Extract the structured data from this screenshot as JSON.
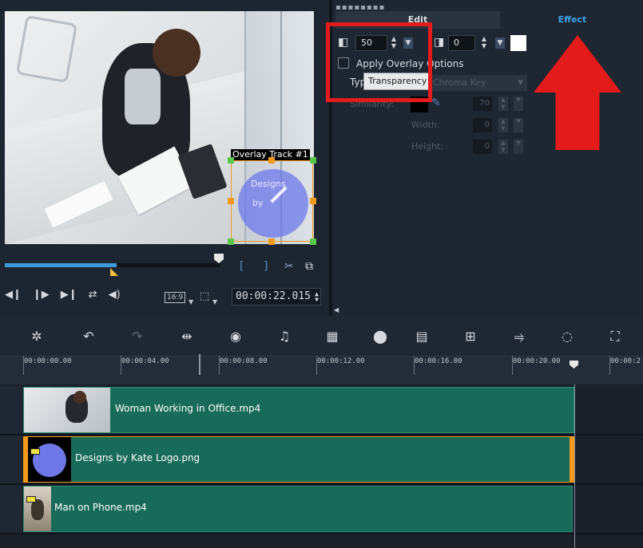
{
  "preview": {
    "overlay_label": "Overlay Track #1",
    "logo_text_1": "Designs",
    "logo_text_2": "by",
    "scrub_progress": 0.52,
    "aspect_label": "16:9",
    "timecode": "00:00:22.015",
    "icons": {
      "trim_in": "bracket-left-icon",
      "trim_out": "bracket-right-icon",
      "split": "scissors-icon",
      "copy": "copy-icon",
      "transport": [
        "prev-frame-icon",
        "next-frame-icon",
        "end-icon",
        "repeat-icon",
        "volume-icon"
      ]
    }
  },
  "options": {
    "tabs": [
      {
        "label": "Edit",
        "active": false
      },
      {
        "label": "Effect",
        "active": true
      }
    ],
    "opacity_value": "50",
    "border_value": "0",
    "apply_overlay_label": "Apply Overlay Options",
    "type_label": "Type:",
    "type_value": "Chroma Key",
    "tooltip": "Transparency",
    "similarity_label": "Similarity:",
    "similarity_value": "70",
    "width_label": "Width:",
    "width_value": "0",
    "height_label": "Height:",
    "height_value": "0",
    "colors": {
      "border_color": "#ffffff",
      "key_color": "#000000",
      "highlight": "#e31b1b",
      "accent": "#3da4e8"
    }
  },
  "timeline": {
    "toolbar_icons": [
      "tools-icon",
      "undo-icon",
      "redo-icon",
      "fit-icon",
      "record-icon",
      "audio-icon",
      "motion-icon",
      "effect-icon",
      "title-icon",
      "split-screen-icon",
      "motion-tracking-icon",
      "mask-icon",
      "subtitle-icon"
    ],
    "ruler_ticks": [
      "00:00:00.00",
      "00:00:04.00",
      "00:00:08.00",
      "00:00:12.00",
      "00:00:16.00",
      "00:00:20.00",
      "00:00:2"
    ],
    "clips": [
      {
        "name": "Woman Working in Office.mp4",
        "selected": false
      },
      {
        "name": "Designs by Kate Logo.png",
        "selected": true
      },
      {
        "name": "Man on Phone.mp4",
        "selected": false
      }
    ]
  }
}
